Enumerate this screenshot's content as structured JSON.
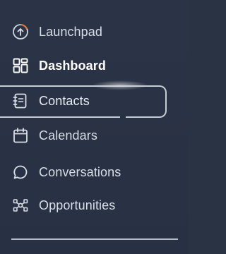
{
  "sidebar": {
    "items": [
      {
        "label": "Launchpad",
        "icon": "launchpad-icon"
      },
      {
        "label": "Dashboard",
        "icon": "dashboard-grid-icon"
      },
      {
        "label": "Contacts",
        "icon": "contacts-book-icon"
      },
      {
        "label": "Calendars",
        "icon": "calendar-icon"
      },
      {
        "label": "Conversations",
        "icon": "chat-bubble-icon"
      },
      {
        "label": "Opportunities",
        "icon": "opportunities-icon"
      }
    ],
    "active_index": 1,
    "hovered_index": 2
  },
  "colors": {
    "background": "#2a3344",
    "text": "#d9dee7",
    "active_text": "#ffffff",
    "launchpad_accent": "#e0743a"
  }
}
